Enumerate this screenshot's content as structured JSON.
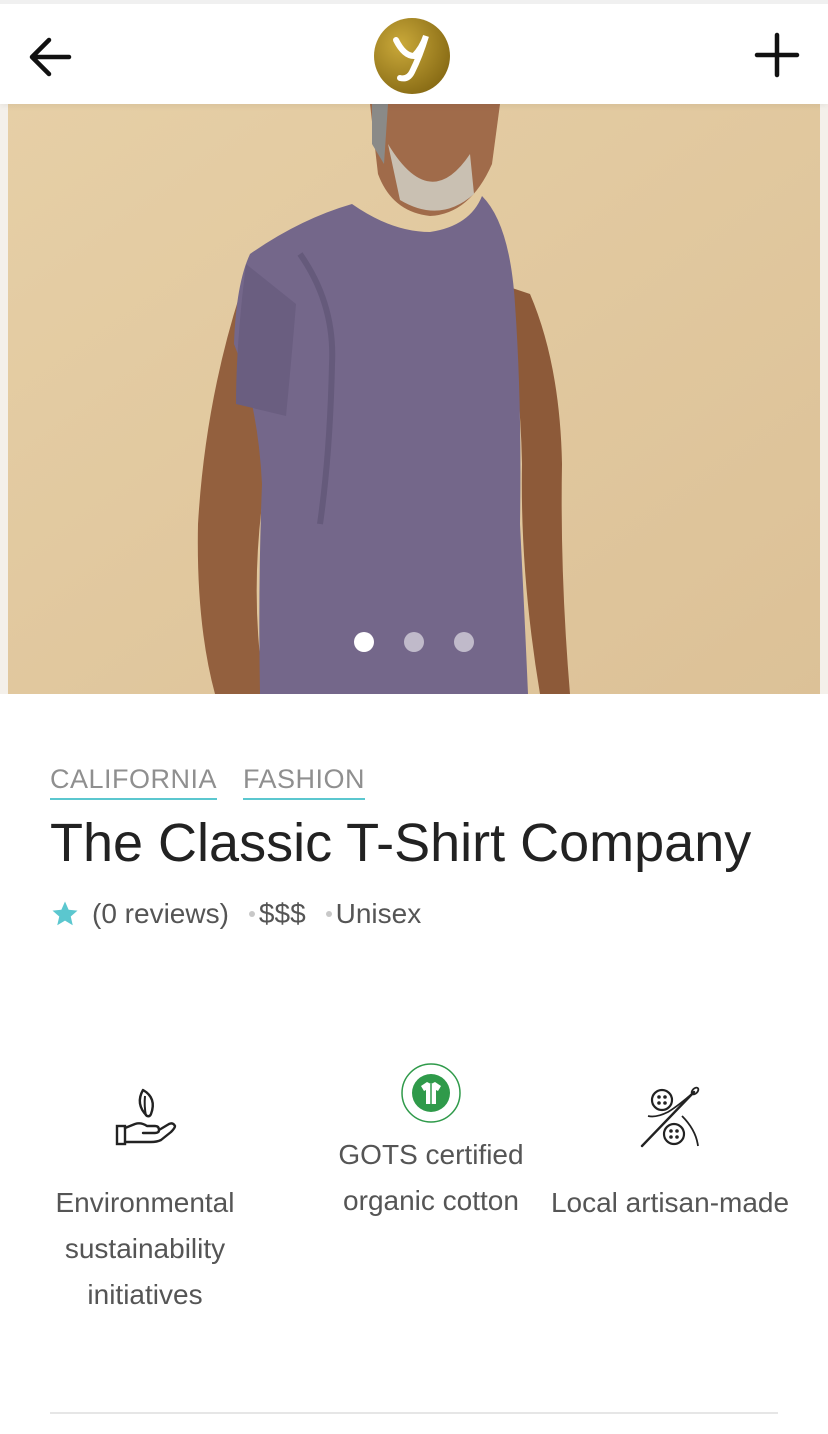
{
  "header": {
    "back_icon": "arrow-left-icon",
    "logo_icon": "brand-logo-y",
    "add_icon": "plus-icon"
  },
  "gallery": {
    "image": "man-wearing-purple-tshirt",
    "slide_count": 3,
    "active_slide": 1
  },
  "store": {
    "tags": [
      "CALIFORNIA",
      "FASHION"
    ],
    "name": "The Classic T-Shirt Company",
    "rating_icon": "star-icon",
    "reviews": "(0 reviews)",
    "price": "$$$",
    "gender": "Unisex"
  },
  "features": [
    {
      "icon": "hand-leaf-icon",
      "label": "Environmental sustainability initiatives"
    },
    {
      "icon": "gots-certified-icon",
      "label": "GOTS certified organic cotton"
    },
    {
      "icon": "needle-buttons-icon",
      "label": "Local artisan-made"
    }
  ],
  "colors": {
    "accent": "#5bc7cf",
    "gots_green": "#2f9a4a",
    "logo_gold": "#b8962a"
  }
}
